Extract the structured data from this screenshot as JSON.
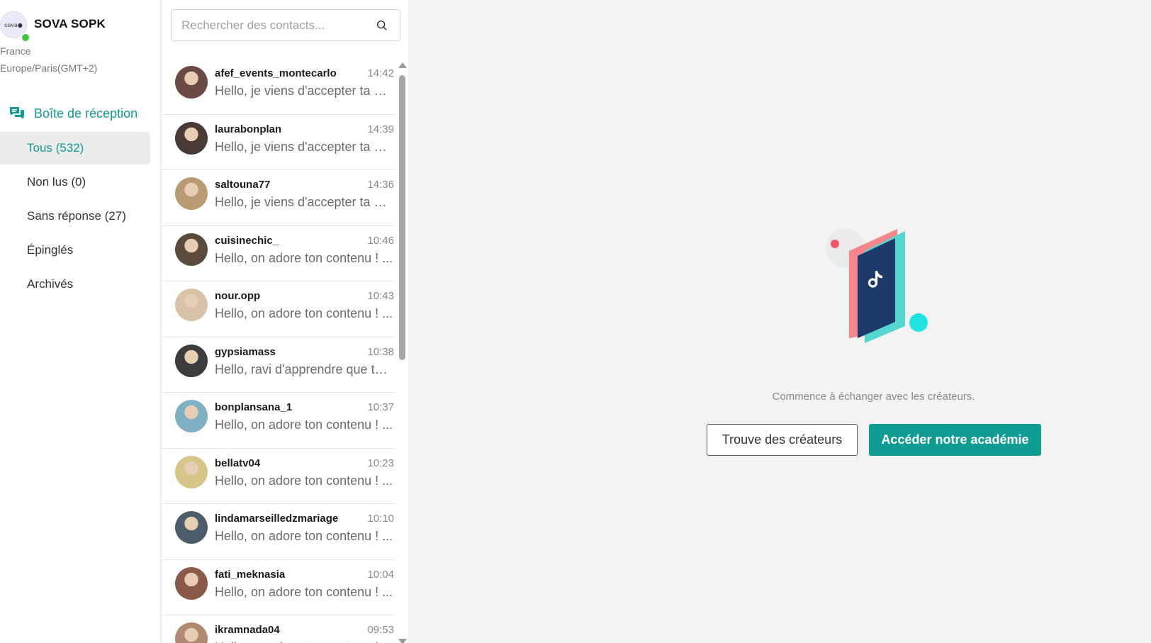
{
  "profile": {
    "logo_text": "sova●",
    "name": "SOVA SOPK",
    "country": "France",
    "timezone": "Europe/Paris(GMT+2)"
  },
  "inbox": {
    "title": "Boîte de réception",
    "icon": "chat-bubbles-icon",
    "filters": [
      {
        "label": "Tous (532)",
        "active": true
      },
      {
        "label": "Non lus (0)",
        "active": false
      },
      {
        "label": "Sans réponse (27)",
        "active": false
      },
      {
        "label": "Épinglés",
        "active": false
      },
      {
        "label": "Archivés",
        "active": false
      }
    ]
  },
  "search": {
    "placeholder": "Rechercher des contacts...",
    "value": ""
  },
  "contacts": [
    {
      "name": "afef_events_montecarlo",
      "time": "14:42",
      "message": "Hello, je viens d'accepter ta demande...",
      "avatar_color": "#6b4a45"
    },
    {
      "name": "laurabonplan",
      "time": "14:39",
      "message": "Hello, je viens d'accepter ta demande...",
      "avatar_color": "#4a3a36"
    },
    {
      "name": "saltouna77",
      "time": "14:36",
      "message": "Hello, je viens d'accepter ta demande...",
      "avatar_color": "#b99a72"
    },
    {
      "name": "cuisinechic_",
      "time": "10:46",
      "message": "Hello, on adore ton contenu ! ...",
      "avatar_color": "#5b4b3c"
    },
    {
      "name": "nour.opp",
      "time": "10:43",
      "message": "Hello, on adore ton contenu ! ...",
      "avatar_color": "#d9c3a8"
    },
    {
      "name": "gypsiamass",
      "time": "10:38",
      "message": "Hello, ravi d'apprendre que tu ...",
      "avatar_color": "#3c3c3c"
    },
    {
      "name": "bonplansana_1",
      "time": "10:37",
      "message": "Hello, on adore ton contenu ! ...",
      "avatar_color": "#7fb0c4"
    },
    {
      "name": "bellatv04",
      "time": "10:23",
      "message": "Hello, on adore ton contenu ! ...",
      "avatar_color": "#d7c58a"
    },
    {
      "name": "lindamarseilledzmariage",
      "time": "10:10",
      "message": "Hello, on adore ton contenu ! ...",
      "avatar_color": "#4d5c6a"
    },
    {
      "name": "fati_meknasia",
      "time": "10:04",
      "message": "Hello, on adore ton contenu ! ...",
      "avatar_color": "#8a5a48"
    },
    {
      "name": "ikramnada04",
      "time": "09:53",
      "message": "Hello, on adore ton contenu ! ...",
      "avatar_color": "#b08a70"
    }
  ],
  "main": {
    "illustration_icon": "tiktok-phone-icon",
    "empty_text": "Commence à échanger avec les créateurs.",
    "find_creators_label": "Trouve des créateurs",
    "academy_label": "Accéder notre académie"
  },
  "colors": {
    "accent": "#109c93",
    "online": "#3ec43e",
    "pink": "#f4868c",
    "teal": "#55d6d0",
    "navy": "#1e3a6a"
  }
}
